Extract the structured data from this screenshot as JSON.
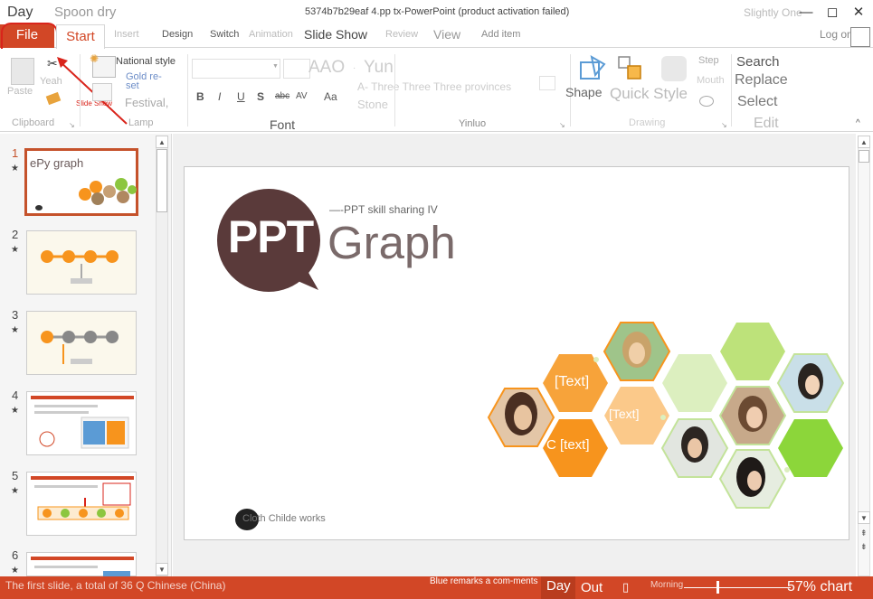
{
  "titlebar": {
    "left1": "Day",
    "left2": "Spoon dry",
    "title": "5374b7b29eaf 4.pp tx-PowerPoint (product activation failed)",
    "user": "Slightly One",
    "minimize": "—",
    "restore": "◻",
    "close": "✕"
  },
  "tabs": {
    "file": "File",
    "start": "Start",
    "insert": "Insert",
    "design": "Design",
    "switch": "Switch",
    "animation": "Animation",
    "slideshow": "Slide Show",
    "review": "Review",
    "view": "View",
    "additem": "Add item",
    "login": "Log on"
  },
  "ribbon": {
    "clipboard": {
      "paste": "Paste",
      "yeah": "Yeah",
      "label": "Clipboard",
      "slideshow_tip": "Slide Show"
    },
    "slides": {
      "national": "National style",
      "gold": "Gold re-set",
      "festival": "Festival,",
      "lamp": "Lamp"
    },
    "font": {
      "aao": "AAO",
      "yun": "Yun",
      "bold": "B",
      "italic": "I",
      "underline": "U",
      "shadow": "S",
      "strike": "abc",
      "spacing": "AV",
      "case": "Aa",
      "three": "A- Three Three Three provinces",
      "stone": "Stone",
      "label": "Font"
    },
    "yinluo": {
      "label": "Yinluo"
    },
    "drawing": {
      "shape": "Shape",
      "quick": "Quick Style",
      "step": "Step",
      "mouth": "Mouth",
      "label": "Drawing"
    },
    "edit": {
      "search": "Search",
      "replace": "Replace",
      "select": "Select",
      "label": "Edit"
    }
  },
  "thumbnails": [
    {
      "num": "1",
      "star": "★",
      "caption": "ePy graph"
    },
    {
      "num": "2",
      "star": "★"
    },
    {
      "num": "3",
      "star": "★"
    },
    {
      "num": "4",
      "star": "★"
    },
    {
      "num": "5",
      "star": "★"
    },
    {
      "num": "6",
      "star": "★"
    }
  ],
  "slide": {
    "subtitle": "—-PPT skill sharing IV",
    "badge": "PPT",
    "title": "Graph",
    "hex_text1": "[Text]",
    "hex_text2": "[Text]",
    "hex_text3": "C [text]",
    "footer": "Cloth Childe works"
  },
  "status": {
    "slide_info": "The first slide, a total of 36 Q Chinese (China)",
    "remarks": "Blue remarks a com-ments",
    "day": "Day",
    "out": "Out",
    "morning": "Morning",
    "zoom": "57% chart"
  },
  "colors": {
    "accent": "#d24726",
    "badge": "#5a3a3a",
    "hex_orange": "#f7941d",
    "hex_green": "#8cc63f"
  }
}
